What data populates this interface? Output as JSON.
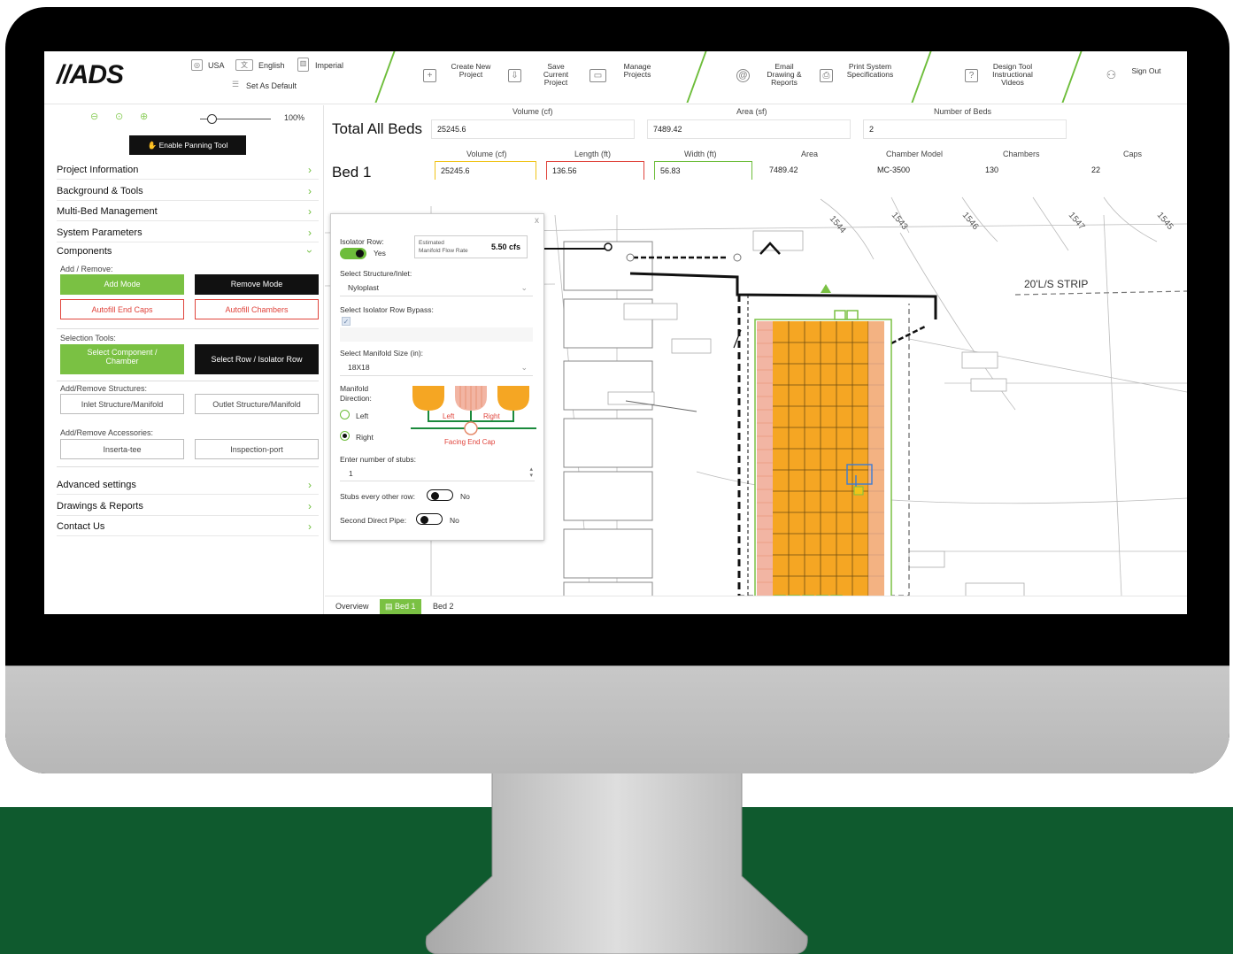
{
  "header": {
    "logo": "//ADS",
    "country": "USA",
    "language": "English",
    "units": "Imperial",
    "set_default": "Set As Default",
    "nav": [
      {
        "label": "Create New\nProject",
        "icon": "plus-square-icon"
      },
      {
        "label": "Save\nCurrent\nProject",
        "icon": "save-icon"
      },
      {
        "label": "Manage\nProjects",
        "icon": "folder-icon"
      },
      {
        "label": "Email\nDrawing &\nReports",
        "icon": "email-icon"
      },
      {
        "label": "Print System\nSpecifications",
        "icon": "printer-icon"
      },
      {
        "label": "Design Tool\nInstructional\nVideos",
        "icon": "help-icon"
      },
      {
        "label": "Sign Out",
        "icon": "user-icon"
      }
    ]
  },
  "sidebar": {
    "zoom_percent": "100%",
    "panning_button": "Enable Panning Tool",
    "menu_top": [
      "Project Information",
      "Background & Tools",
      "Multi-Bed Management",
      "System Parameters",
      "Components"
    ],
    "add_remove_label": "Add / Remove:",
    "add_mode": "Add Mode",
    "remove_mode": "Remove Mode",
    "autofill_end_caps": "Autofill End Caps",
    "autofill_chambers": "Autofill Chambers",
    "selection_tools_label": "Selection Tools:",
    "select_component": "Select Component /\nChamber",
    "select_row": "Select Row / Isolator Row",
    "structures_label": "Add/Remove Structures:",
    "inlet_structure": "Inlet Structure/Manifold",
    "outlet_structure": "Outlet Structure/Manifold",
    "accessories_label": "Add/Remove Accessories:",
    "inserta_tee": "Inserta-tee",
    "inspection_port": "Inspection-port",
    "menu_bottom": [
      "Advanced settings",
      "Drawings & Reports",
      "Contact Us"
    ]
  },
  "totals": {
    "title": "Total All Beds",
    "headers": [
      "Volume (cf)",
      "Area (sf)",
      "Number of Beds"
    ],
    "values": [
      "25245.6",
      "7489.42",
      "2"
    ]
  },
  "bed": {
    "title": "Bed 1",
    "headers": [
      "Volume (cf)",
      "Length (ft)",
      "Width (ft)",
      "Area",
      "Chamber Model",
      "Chambers",
      "Caps"
    ],
    "values": [
      "25245.6",
      "136.56",
      "56.83",
      "7489.42",
      "MC-3500",
      "130",
      "22"
    ]
  },
  "popup": {
    "close": "x",
    "isolator_row_label": "Isolator Row:",
    "isolator_row_value": "Yes",
    "flow_label": "Estimated\nManifold Flow Rate",
    "flow_value": "5.50 cfs",
    "structure_label": "Select Structure/Inlet:",
    "structure_value": "Nyloplast",
    "bypass_label": "Select Isolator Row Bypass:",
    "manifold_size_label": "Select Manifold Size (in):",
    "manifold_size_value": "18X18",
    "direction_label": "Manifold\nDirection:",
    "left": "Left",
    "right": "Right",
    "diagram_left": "Left",
    "diagram_right": "Right",
    "facing_end_cap": "Facing End Cap",
    "stubs_label": "Enter number of stubs:",
    "stubs_value": "1",
    "stubs_other_label": "Stubs every other row:",
    "stubs_other_value": "No",
    "second_pipe_label": "Second Direct Pipe:",
    "second_pipe_value": "No"
  },
  "drawing": {
    "strip_label": "20'L/S STRIP",
    "contours": [
      "1547",
      "1546",
      "1545",
      "1544",
      "1543"
    ]
  },
  "tabs": [
    "Overview",
    "Bed 1",
    "Bed 2"
  ],
  "colors": {
    "accent_green": "#7ac143",
    "chamber_orange": "#f5a623",
    "floor_green": "#0f5a2e",
    "warning_red": "#e0443c"
  }
}
